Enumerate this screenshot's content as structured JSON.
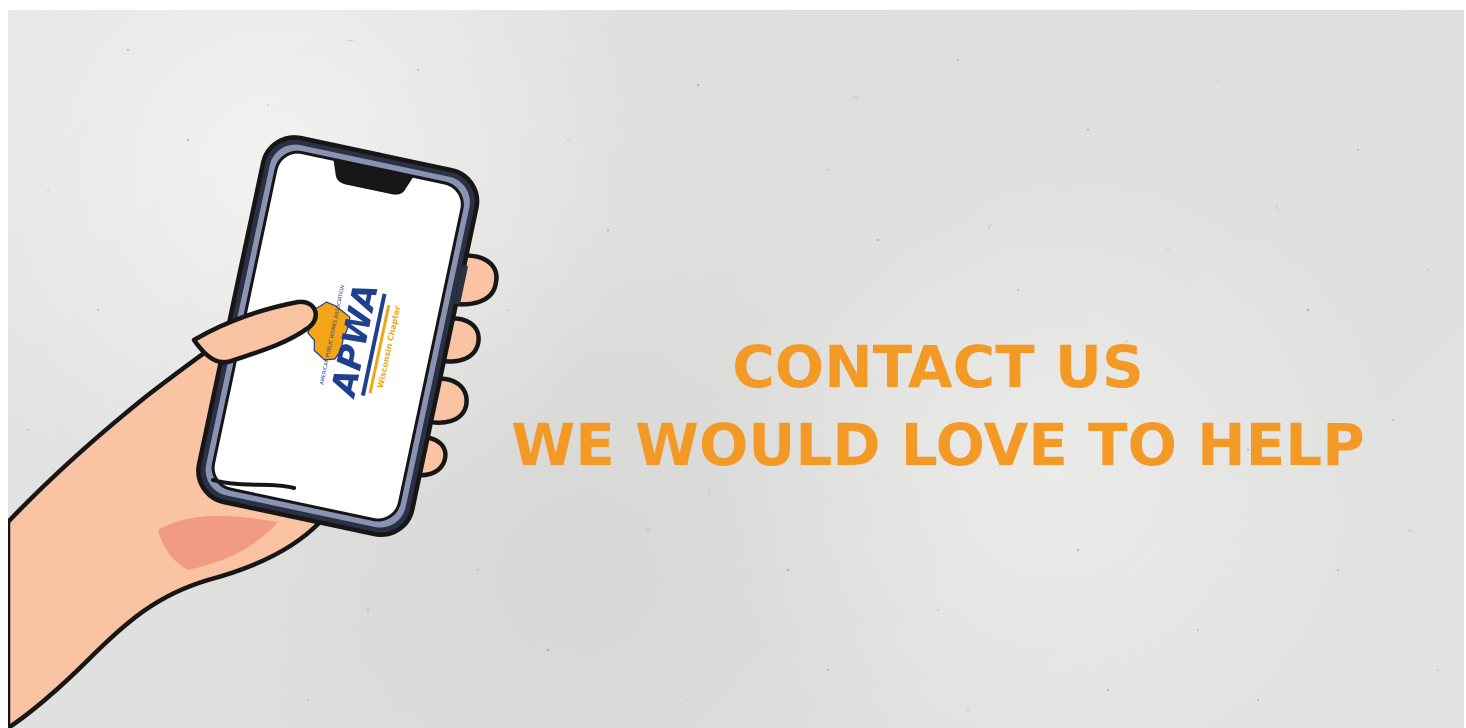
{
  "banner": {
    "heading_line_1": "CONTACT US",
    "heading_line_2": "WE WOULD LOVE TO HELP",
    "accent_color": "#f39a26",
    "background_color": "#e2e2e0"
  },
  "phone_screen": {
    "logo_wordmark": "APWA",
    "logo_arc_text": "AMERICAN PUBLIC WORKS ASSOCIATION",
    "logo_chapter_text": "Wisconsin Chapter",
    "logo_colors": {
      "navy": "#1f3f8f",
      "gold": "#f2a516"
    }
  },
  "icons": {
    "hand": "hand-holding-phone-illustration",
    "state_shape": "wisconsin-map-icon"
  }
}
